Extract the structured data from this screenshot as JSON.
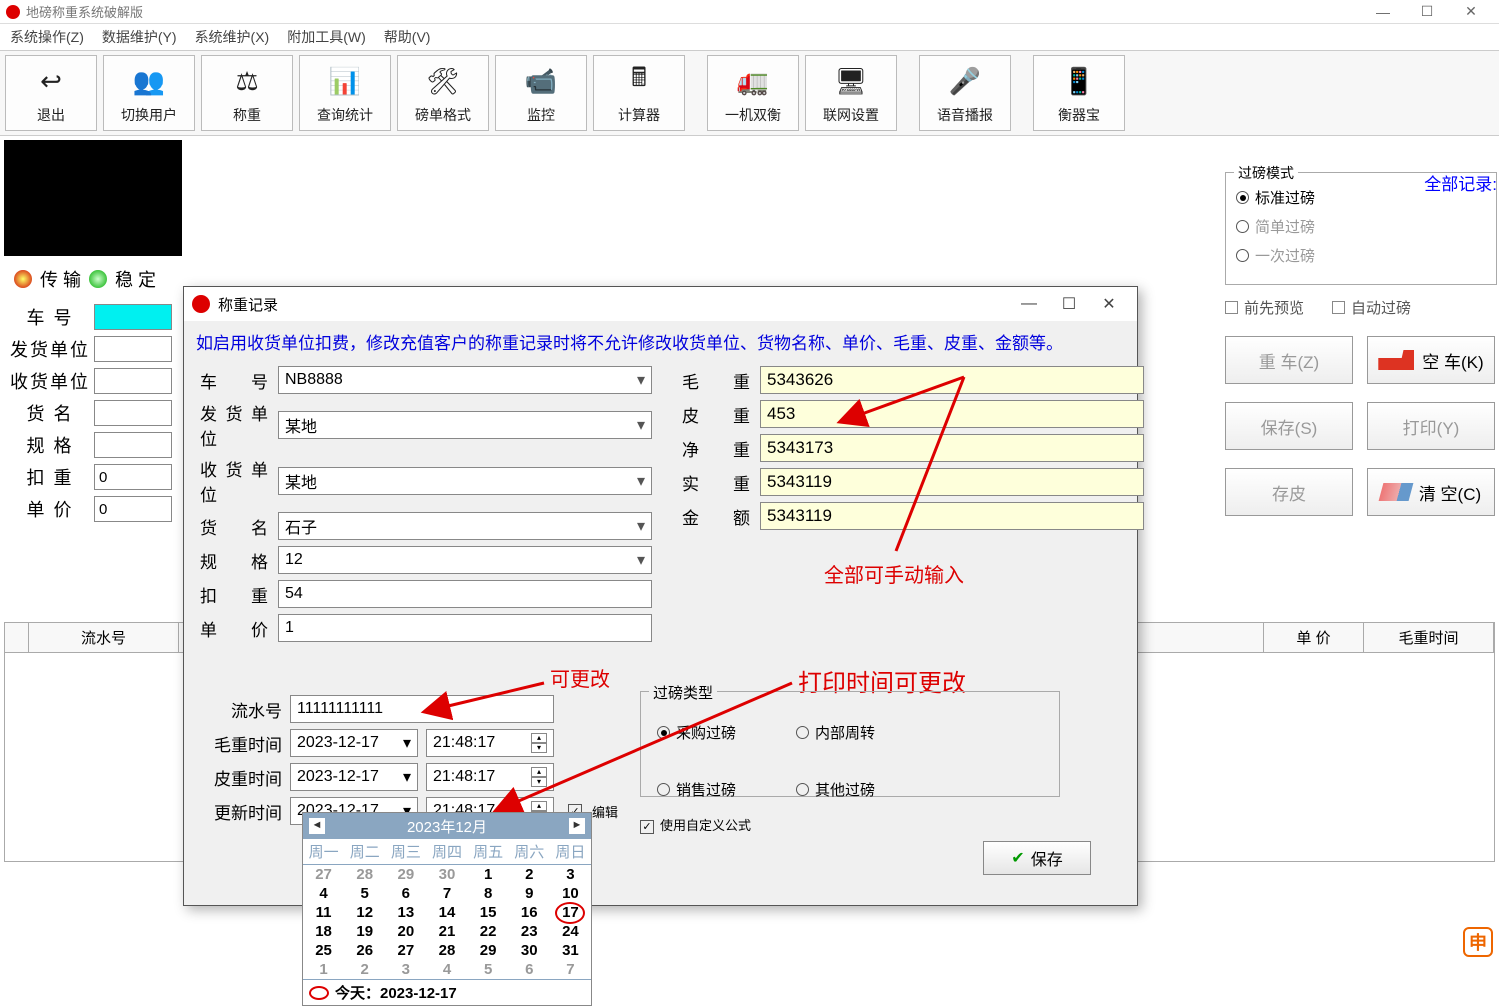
{
  "window": {
    "title": "地磅称重系统破解版"
  },
  "menus": [
    "系统操作(Z)",
    "数据维护(Y)",
    "系统维护(X)",
    "附加工具(W)",
    "帮助(V)"
  ],
  "toolbar": [
    {
      "label": "退出",
      "icon": "↩"
    },
    {
      "label": "切换用户",
      "icon": "👥"
    },
    {
      "label": "称重",
      "icon": "⚖"
    },
    {
      "label": "查询统计",
      "icon": "📊"
    },
    {
      "label": "磅单格式",
      "icon": "🛠"
    },
    {
      "label": "监控",
      "icon": "📹"
    },
    {
      "label": "计算器",
      "icon": "🖩"
    },
    {
      "label": "一机双衡",
      "icon": "🚛"
    },
    {
      "label": "联网设置",
      "icon": "🖥"
    },
    {
      "label": "语音播报",
      "icon": "🎤"
    },
    {
      "label": "衡器宝",
      "icon": "📱"
    }
  ],
  "status": {
    "t1": "传 输",
    "t2": "稳 定"
  },
  "left_form": {
    "labels": [
      "车 号",
      "发货单位",
      "收货单位",
      "货 名",
      "规 格",
      "扣 重",
      "单 价"
    ],
    "values": [
      "",
      "",
      "",
      "",
      "",
      "0",
      "0"
    ]
  },
  "all_records": "全部记录:",
  "mode": {
    "legend": "过磅模式",
    "opts": [
      "标准过磅",
      "简单过磅",
      "一次过磅"
    ]
  },
  "checks": {
    "preview": "前先预览",
    "auto": "自动过磅"
  },
  "buttons": {
    "heavy": "重 车(Z)",
    "empty": "空 车(K)",
    "save": "保存(S)",
    "print": "打印(Y)",
    "store": "存皮",
    "clear": "清 空(C)"
  },
  "table_headers": [
    "流水号",
    "单 价",
    "毛重时间"
  ],
  "dialog": {
    "title": "称重记录",
    "notice": "如启用收货单位扣费，修改充值客户的称重记录时将不允许修改收货单位、货物名称、单价、毛重、皮重、金额等。",
    "left": {
      "车 号": "NB8888",
      "发货单位": "某地",
      "收货单位": "某地",
      "货 名": "石子",
      "规 格": "12",
      "扣 重": "54",
      "单 价": "1"
    },
    "right": {
      "毛 重": "5343626",
      "皮 重": "453",
      "净 重": "5343173",
      "实 重": "5343119",
      "金 额": "5343119"
    },
    "anno1": "全部可手动输入",
    "anno2": "可更改",
    "anno3": "打印时间可更改",
    "lower": {
      "serial_lbl": "流水号",
      "serial": "11111111111",
      "mz_lbl": "毛重时间",
      "pz_lbl": "皮重时间",
      "upd_lbl": "更新时间",
      "date": "2023-12-17",
      "time": "21:48:17",
      "edit": "编辑"
    },
    "group": {
      "legend": "过磅类型",
      "opts": [
        "采购过磅",
        "内部周转",
        "销售过磅",
        "其他过磅"
      ],
      "chk": "使用自定义公式"
    },
    "save_btn": "保存"
  },
  "calendar": {
    "title": "2023年12月",
    "dows": [
      "周一",
      "周二",
      "周三",
      "周四",
      "周五",
      "周六",
      "周日"
    ],
    "grid": [
      [
        "27",
        "28",
        "29",
        "30",
        "1",
        "2",
        "3"
      ],
      [
        "4",
        "5",
        "6",
        "7",
        "8",
        "9",
        "10"
      ],
      [
        "11",
        "12",
        "13",
        "14",
        "15",
        "16",
        "17"
      ],
      [
        "18",
        "19",
        "20",
        "21",
        "22",
        "23",
        "24"
      ],
      [
        "25",
        "26",
        "27",
        "28",
        "29",
        "30",
        "31"
      ],
      [
        "1",
        "2",
        "3",
        "4",
        "5",
        "6",
        "7"
      ]
    ],
    "today": "今天：2023-12-17"
  }
}
